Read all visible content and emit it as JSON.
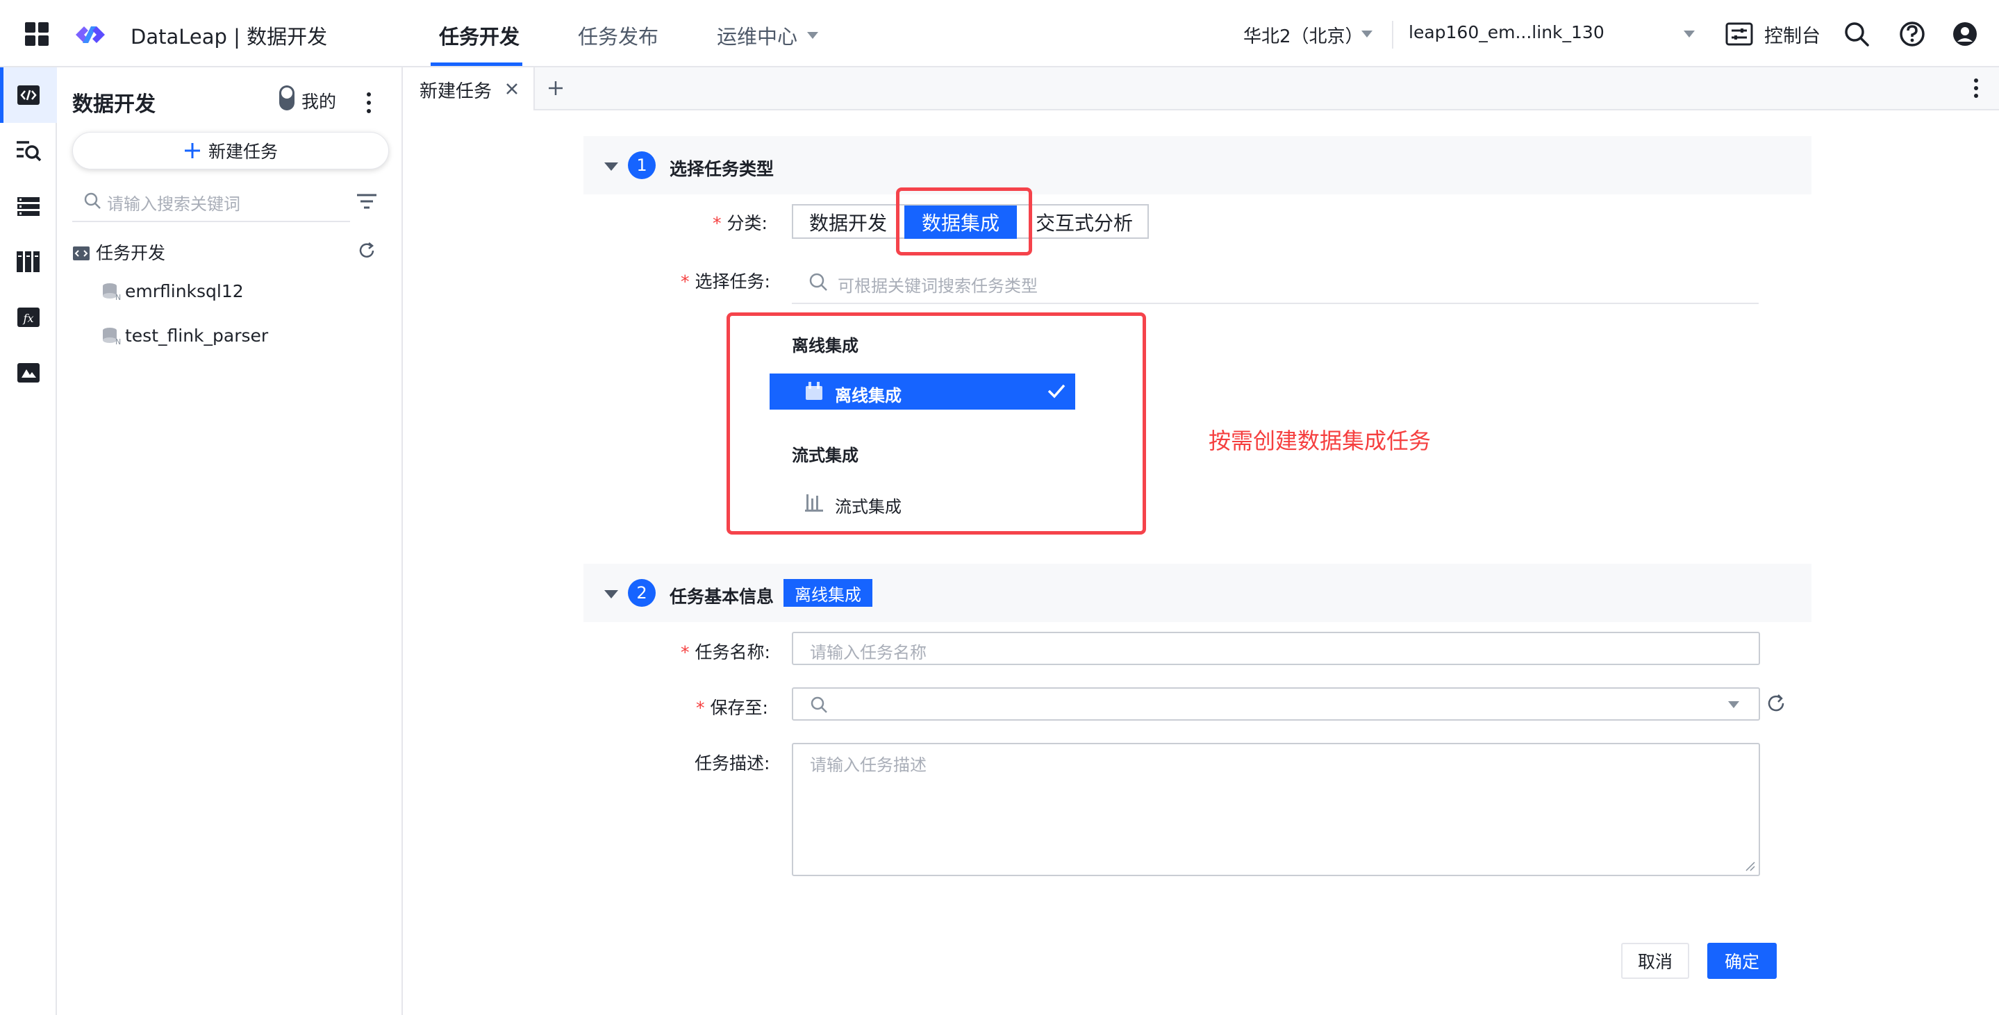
{
  "topbar": {
    "app_title": "DataLeap | 数据开发",
    "nav_tabs": [
      {
        "label": "任务开发",
        "active": true
      },
      {
        "label": "任务发布",
        "active": false
      },
      {
        "label": "运维中心",
        "active": false
      }
    ],
    "region": "华北2（北京）",
    "project": "leap160_em...link_130",
    "console_label": "控制台",
    "icons": [
      "apps-grid-icon",
      "logo-icon",
      "console-icon",
      "search-icon",
      "help-icon",
      "user-icon"
    ]
  },
  "rail": {
    "items": [
      "code-icon",
      "query-icon",
      "table-list-icon",
      "library-icon",
      "function-icon",
      "resource-icon"
    ],
    "active_index": 0
  },
  "sidepanel": {
    "title": "数据开发",
    "toggle_label": "我的",
    "new_task_label": "新建任务",
    "search_placeholder": "请输入搜索关键词",
    "tree_root": "任务开发",
    "tree_items": [
      "emrflinksql12",
      "test_flink_parser"
    ]
  },
  "tabs": {
    "items": [
      {
        "label": "新建任务"
      }
    ]
  },
  "section1": {
    "step": "1",
    "title": "选择任务类型",
    "category_label": "分类:",
    "categories": [
      {
        "label": "数据开发",
        "selected": false
      },
      {
        "label": "数据集成",
        "selected": true
      },
      {
        "label": "交互式分析",
        "selected": false
      }
    ],
    "task_label": "选择任务:",
    "task_search_placeholder": "可根据关键词搜索任务类型",
    "groups": [
      {
        "title": "离线集成",
        "options": [
          {
            "label": "离线集成",
            "selected": true
          }
        ]
      },
      {
        "title": "流式集成",
        "options": [
          {
            "label": "流式集成",
            "selected": false
          }
        ]
      }
    ]
  },
  "annotation": "按需创建数据集成任务",
  "section2": {
    "step": "2",
    "title": "任务基本信息",
    "tag": "离线集成",
    "name_label": "任务名称:",
    "name_placeholder": "请输入任务名称",
    "save_label": "保存至:",
    "desc_label": "任务描述:",
    "desc_placeholder": "请输入任务描述"
  },
  "footer": {
    "cancel_label": "取消",
    "confirm_label": "确定"
  },
  "colors": {
    "accent": "#1664ff",
    "annotation_red": "#f53f3f"
  }
}
